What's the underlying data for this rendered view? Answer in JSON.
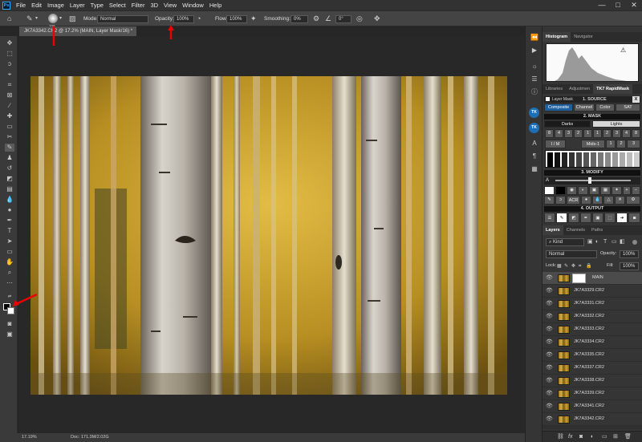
{
  "menubar": {
    "logo": "Ps",
    "items": [
      "File",
      "Edit",
      "Image",
      "Layer",
      "Type",
      "Select",
      "Filter",
      "3D",
      "View",
      "Window",
      "Help"
    ],
    "window_controls": [
      "—",
      "□",
      "✕"
    ]
  },
  "options_bar": {
    "brush_size": "100",
    "mode_label": "Mode:",
    "mode_value": "Normal",
    "opacity_label": "Opacity:",
    "opacity_value": "100%",
    "flow_label": "Flow:",
    "flow_value": "100%",
    "smoothing_label": "Smoothing:",
    "smoothing_value": "0%",
    "angle_value": "0°"
  },
  "document_tab": {
    "title": "JK7A3342.CR2 @ 17.2% (MAIN, Layer Mask/16) *",
    "close": "✕"
  },
  "status_bar": {
    "zoom": "17.19%",
    "doc_info": "Doc: 171.3M/2.02G"
  },
  "histogram_panel": {
    "tabs": [
      "Histogram",
      "Navigator"
    ],
    "warning": "⚠"
  },
  "rapidmask_panel": {
    "tabs": [
      "Libraries",
      "Adjustmen",
      "TK7 RapidMask"
    ],
    "layer_mask_label": "Layer Mask",
    "source_header": "1. SOURCE",
    "close_x": "X",
    "source_buttons": [
      "Composite",
      "Channel",
      "Color",
      "SAT"
    ],
    "mask_header": "2. MASK",
    "mask_tabs": [
      "Darks",
      "Lights"
    ],
    "number_row": [
      "8",
      "4",
      "3",
      "2",
      "1",
      "1",
      "2",
      "3",
      "4",
      "8"
    ],
    "im_label": "I / M",
    "mids_label": "Mids-1",
    "mids_numbers": [
      "1",
      "2",
      "3"
    ],
    "modify_header": "3. MODIFY",
    "modify_letter": "A",
    "acr_label": "ACR",
    "output_header": "4. OUTPUT"
  },
  "layers_panel": {
    "tabs": [
      "Layers",
      "Channels",
      "Paths"
    ],
    "kind_label": "Kind",
    "blend_mode": "Normal",
    "opacity_label": "Opacity:",
    "opacity_value": "100%",
    "lock_label": "Lock:",
    "fill_label": "Fill:",
    "fill_value": "100%",
    "layers": [
      {
        "name": "MAIN",
        "has_mask": true,
        "selected": true
      },
      {
        "name": "JK7A3329.CR2"
      },
      {
        "name": "JK7A3331.CR2"
      },
      {
        "name": "JK7A3332.CR2"
      },
      {
        "name": "JK7A3333.CR2"
      },
      {
        "name": "JK7A3334.CR2"
      },
      {
        "name": "JK7A3335.CR2"
      },
      {
        "name": "JK7A3337.CR2"
      },
      {
        "name": "JK7A3338.CR2"
      },
      {
        "name": "JK7A3339.CR2"
      },
      {
        "name": "JK7A3341.CR2"
      },
      {
        "name": "JK7A3342.CR2"
      }
    ],
    "footer_icons": [
      "link-icon",
      "fx-icon",
      "mask-icon",
      "adjustment-icon",
      "folder-icon",
      "new-layer-icon",
      "trash-icon"
    ]
  },
  "colors": {
    "accent": "#31a8ff",
    "annotation_arrow": "#e00000",
    "photo_gold": "#c9a23a"
  }
}
